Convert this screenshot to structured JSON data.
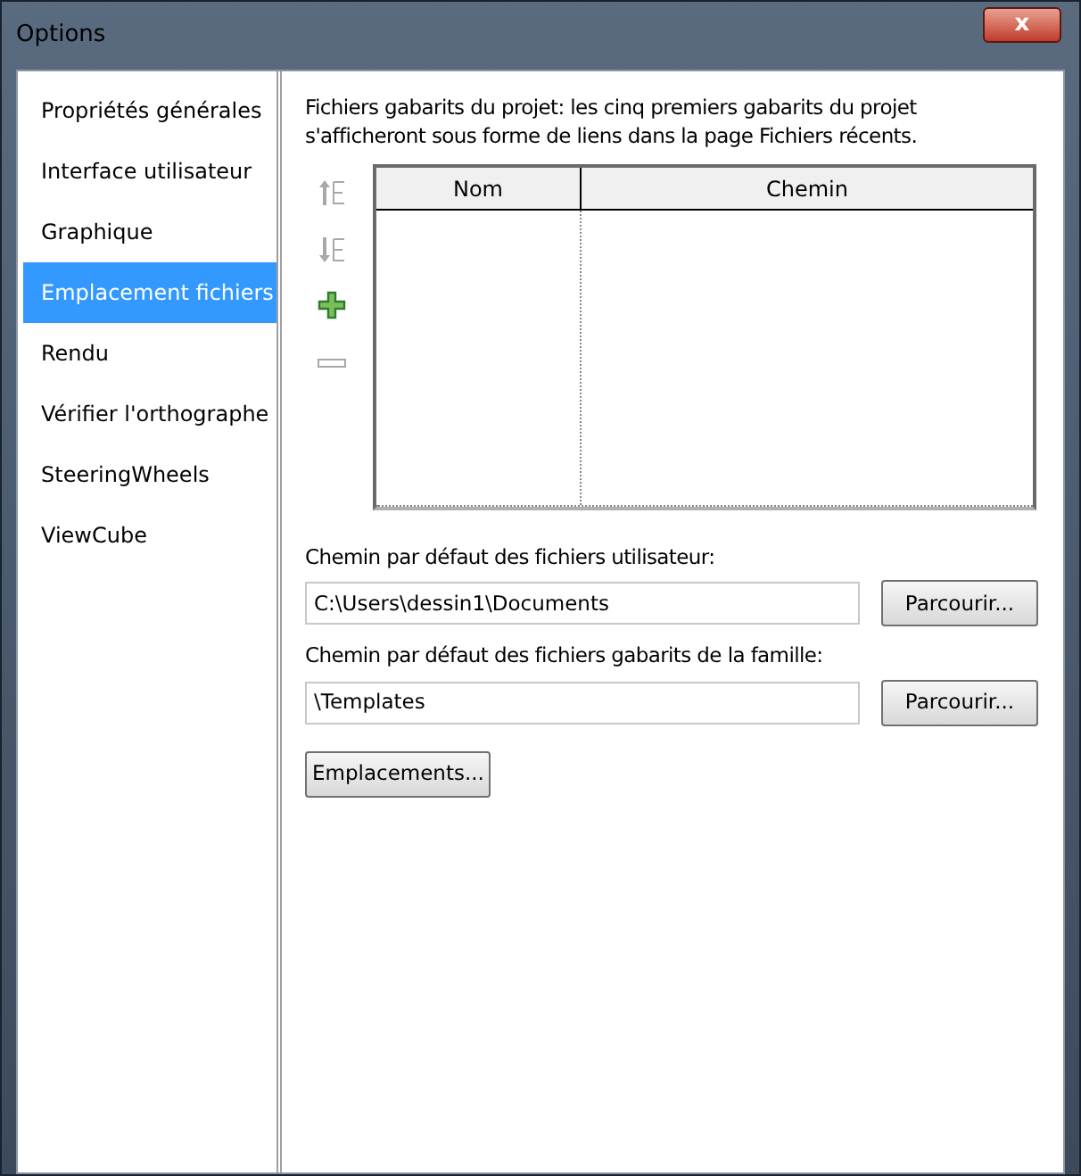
{
  "window": {
    "title": "Options",
    "close_label": "x"
  },
  "sidebar": {
    "items": [
      {
        "label": "Propriétés générales",
        "selected": false
      },
      {
        "label": "Interface utilisateur",
        "selected": false
      },
      {
        "label": "Graphique",
        "selected": false
      },
      {
        "label": "Emplacement fichiers",
        "selected": true
      },
      {
        "label": "Rendu",
        "selected": false
      },
      {
        "label": "Vérifier l'orthographe",
        "selected": false
      },
      {
        "label": "SteeringWheels",
        "selected": false
      },
      {
        "label": "ViewCube",
        "selected": false
      }
    ]
  },
  "description": "Fichiers gabarits du projet: les cinq premiers gabarits du projet s'afficheront sous forme de liens dans la page Fichiers récents.",
  "tools": [
    {
      "kind": "move-up",
      "disabled": true
    },
    {
      "kind": "move-down",
      "disabled": true
    },
    {
      "kind": "add",
      "disabled": false
    },
    {
      "kind": "remove",
      "disabled": true
    }
  ],
  "table": {
    "columns": [
      "Nom",
      "Chemin"
    ]
  },
  "paths": [
    {
      "label": "Chemin par défaut des fichiers utilisateur:",
      "value": "C:\\Users\\dessin1\\Documents",
      "button": "Parcourir..."
    },
    {
      "label": "Chemin par défaut des fichiers gabarits de la famille:",
      "value": "\\Templates",
      "button": "Parcourir..."
    }
  ],
  "locations_button": "Emplacements..."
}
